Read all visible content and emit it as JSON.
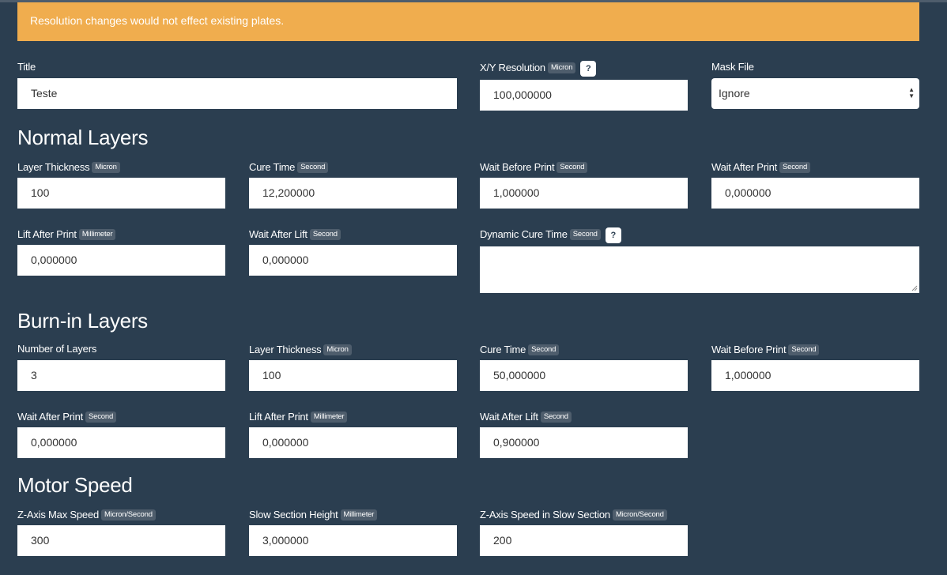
{
  "alert": {
    "text": "Resolution changes would not effect existing plates."
  },
  "general": {
    "title": {
      "label": "Title",
      "value": "Teste"
    },
    "xy_resolution": {
      "label": "X/Y Resolution",
      "unit": "Micron",
      "help": "?",
      "value": "100,000000"
    },
    "mask_file": {
      "label": "Mask File",
      "value": "Ignore"
    }
  },
  "normal_layers": {
    "heading": "Normal Layers",
    "layer_thickness": {
      "label": "Layer Thickness",
      "unit": "Micron",
      "value": "100"
    },
    "cure_time": {
      "label": "Cure Time",
      "unit": "Second",
      "value": "12,200000"
    },
    "wait_before_print": {
      "label": "Wait Before Print",
      "unit": "Second",
      "value": "1,000000"
    },
    "wait_after_print": {
      "label": "Wait After Print",
      "unit": "Second",
      "value": "0,000000"
    },
    "lift_after_print": {
      "label": "Lift After Print",
      "unit": "Millimeter",
      "value": "0,000000"
    },
    "wait_after_lift": {
      "label": "Wait After Lift",
      "unit": "Second",
      "value": "0,000000"
    },
    "dynamic_cure_time": {
      "label": "Dynamic Cure Time",
      "unit": "Second",
      "help": "?",
      "value": ""
    }
  },
  "burnin_layers": {
    "heading": "Burn-in Layers",
    "number_of_layers": {
      "label": "Number of Layers",
      "value": "3"
    },
    "layer_thickness": {
      "label": "Layer Thickness",
      "unit": "Micron",
      "value": "100"
    },
    "cure_time": {
      "label": "Cure Time",
      "unit": "Second",
      "value": "50,000000"
    },
    "wait_before_print": {
      "label": "Wait Before Print",
      "unit": "Second",
      "value": "1,000000"
    },
    "wait_after_print": {
      "label": "Wait After Print",
      "unit": "Second",
      "value": "0,000000"
    },
    "lift_after_print": {
      "label": "Lift After Print",
      "unit": "Millimeter",
      "value": "0,000000"
    },
    "wait_after_lift": {
      "label": "Wait After Lift",
      "unit": "Second",
      "value": "0,900000"
    }
  },
  "motor_speed": {
    "heading": "Motor Speed",
    "z_axis_max_speed": {
      "label": "Z-Axis Max Speed",
      "unit": "Micron/Second",
      "value": "300"
    },
    "slow_section_height": {
      "label": "Slow Section Height",
      "unit": "Millimeter",
      "value": "3,000000"
    },
    "z_axis_speed_slow": {
      "label": "Z-Axis Speed in Slow Section",
      "unit": "Micron/Second",
      "value": "200"
    }
  },
  "colors": {
    "background": "#2b3e50",
    "alert": "#f0ad4e",
    "badge": "#4e5d6c"
  }
}
